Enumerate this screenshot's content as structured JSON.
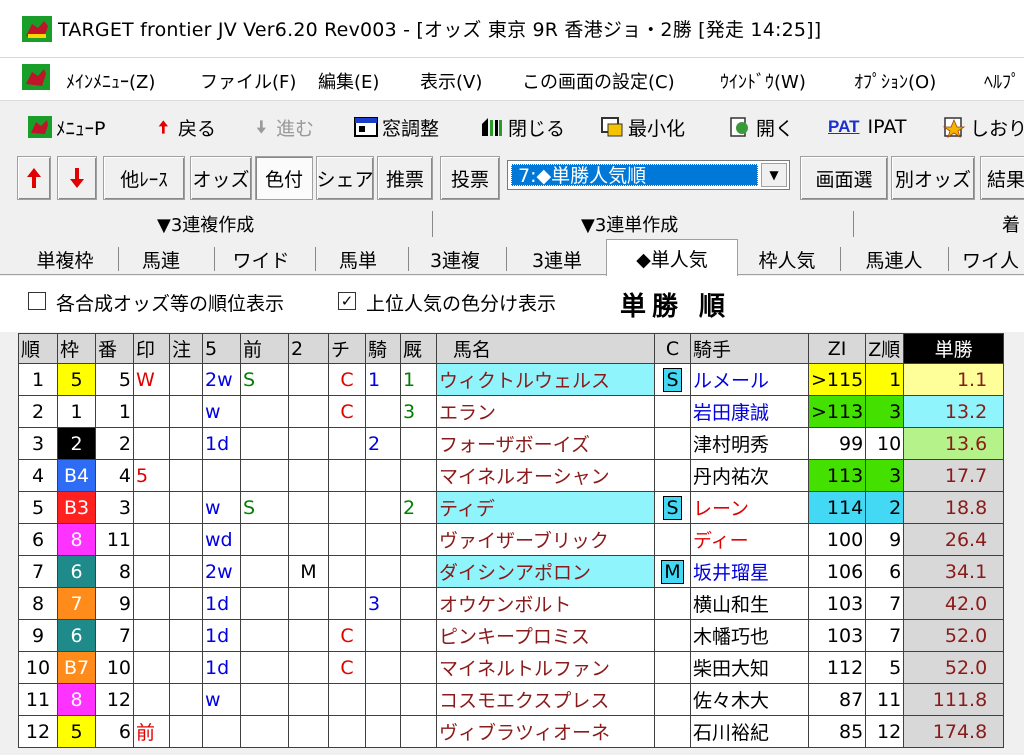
{
  "window": {
    "title": "TARGET frontier JV  Ver6.20  Rev003 - [オッズ 東京 9R 香港ジョ・2勝  [発走 14:25]]"
  },
  "menu": [
    "ﾒｲﾝﾒﾆｭｰ(Z)",
    "ファイル(F)",
    "編集(E)",
    "表示(V)",
    "この画面の設定(C)",
    "ｳｲﾝﾄﾞｳ(W)",
    "ｵﾌﾟｼｮﾝ(O)",
    "ﾍﾙﾌﾟ"
  ],
  "toolbar": {
    "menu_p": "ﾒﾆｭｰP",
    "back": "戻る",
    "forward": "進む",
    "window_adjust": "窓調整",
    "close": "閉じる",
    "minimize": "最小化",
    "open": "開く",
    "pat": "PAT",
    "ipat": "IPAT",
    "bookmark": "しおり"
  },
  "buttons": {
    "other_race": "他ﾚｰｽ",
    "odds": "オッズ",
    "color": "色付",
    "share": "シェア",
    "recommend": "推票",
    "vote": "投票",
    "screen_select": "画面選",
    "other_odds": "別オッズ",
    "result": "結果"
  },
  "combo": {
    "selected": "7:◆単勝人気順"
  },
  "section_headers": [
    "▼3連複作成",
    "▼3連単作成",
    "着"
  ],
  "tabs": [
    "単複枠",
    "馬連",
    "ワイド",
    "馬単",
    "3連複",
    "3連単",
    "◆単人気",
    "枠人気",
    "馬連人",
    "ワイ人"
  ],
  "options": {
    "rank_display": "各合成オッズ等の順位表示",
    "color_popular": "上位人気の色分け表示",
    "title": "単勝 順"
  },
  "colors": {
    "frame1": "#ffffff",
    "frame2": "#000000",
    "frame3": "#ff2020",
    "frame4": "#2f6cf5",
    "frame5": "#ffff00",
    "frame6": "#1f8a8a",
    "frame7": "#ff8c1a",
    "frame8": "#ff33ff"
  },
  "table": {
    "headers": [
      "順",
      "枠",
      "番",
      "印",
      "注",
      "5",
      "前",
      "2",
      "チ",
      "騎",
      "厩",
      "馬名",
      "C",
      "騎手",
      "ZI",
      "Z順",
      "単勝"
    ],
    "rows": [
      {
        "rank": "1",
        "frame": "5",
        "num": "5",
        "mark": "W",
        "note": "",
        "c5": "2w",
        "mae": "S",
        "c2": "",
        "chi": "C",
        "ki": "1",
        "kyu": "1",
        "horse": "ウィクトルウェルス",
        "cflag": "S",
        "jockey": "ルメール",
        "zi": ">115",
        "zrank": "1",
        "odds": "1.1"
      },
      {
        "rank": "2",
        "frame": "1",
        "num": "1",
        "mark": "",
        "note": "",
        "c5": "w",
        "mae": "",
        "c2": "",
        "chi": "C",
        "ki": "",
        "kyu": "3",
        "horse": "エラン",
        "cflag": "",
        "jockey": "岩田康誠",
        "zi": ">113",
        "zrank": "3",
        "odds": "13.2"
      },
      {
        "rank": "3",
        "frame": "2",
        "num": "2",
        "mark": "",
        "note": "",
        "c5": "1d",
        "mae": "",
        "c2": "",
        "chi": "",
        "ki": "2",
        "kyu": "",
        "horse": "フォーザボーイズ",
        "cflag": "",
        "jockey": "津村明秀",
        "zi": "99",
        "zrank": "10",
        "odds": "13.6"
      },
      {
        "rank": "4",
        "frame": "B4",
        "num": "4",
        "mark": "5",
        "note": "",
        "c5": "",
        "mae": "",
        "c2": "",
        "chi": "",
        "ki": "",
        "kyu": "",
        "horse": "マイネルオーシャン",
        "cflag": "",
        "jockey": "丹内祐次",
        "zi": "113",
        "zrank": "3",
        "odds": "17.7"
      },
      {
        "rank": "5",
        "frame": "B3",
        "num": "3",
        "mark": "",
        "note": "",
        "c5": "w",
        "mae": "S",
        "c2": "",
        "chi": "",
        "ki": "",
        "kyu": "2",
        "horse": "ティデ",
        "cflag": "S",
        "jockey": "レーン",
        "zi": "114",
        "zrank": "2",
        "odds": "18.8"
      },
      {
        "rank": "6",
        "frame": "8",
        "num": "11",
        "mark": "",
        "note": "",
        "c5": "wd",
        "mae": "",
        "c2": "",
        "chi": "",
        "ki": "",
        "kyu": "",
        "horse": "ヴァイザーブリック",
        "cflag": "",
        "jockey": "ディー",
        "zi": "100",
        "zrank": "9",
        "odds": "26.4"
      },
      {
        "rank": "7",
        "frame": "6",
        "num": "8",
        "mark": "",
        "note": "",
        "c5": "2w",
        "mae": "",
        "c2": "M",
        "chi": "",
        "ki": "",
        "kyu": "",
        "horse": "ダイシンアポロン",
        "cflag": "M",
        "jockey": "坂井瑠星",
        "zi": "106",
        "zrank": "6",
        "odds": "34.1"
      },
      {
        "rank": "8",
        "frame": "7",
        "num": "9",
        "mark": "",
        "note": "",
        "c5": "1d",
        "mae": "",
        "c2": "",
        "chi": "",
        "ki": "3",
        "kyu": "",
        "horse": "オウケンボルト",
        "cflag": "",
        "jockey": "横山和生",
        "zi": "103",
        "zrank": "7",
        "odds": "42.0"
      },
      {
        "rank": "9",
        "frame": "6",
        "num": "7",
        "mark": "",
        "note": "",
        "c5": "1d",
        "mae": "",
        "c2": "",
        "chi": "C",
        "ki": "",
        "kyu": "",
        "horse": "ピンキープロミス",
        "cflag": "",
        "jockey": "木幡巧也",
        "zi": "103",
        "zrank": "7",
        "odds": "52.0"
      },
      {
        "rank": "10",
        "frame": "B7",
        "num": "10",
        "mark": "",
        "note": "",
        "c5": "1d",
        "mae": "",
        "c2": "",
        "chi": "C",
        "ki": "",
        "kyu": "",
        "horse": "マイネルトルファン",
        "cflag": "",
        "jockey": "柴田大知",
        "zi": "112",
        "zrank": "5",
        "odds": "52.0"
      },
      {
        "rank": "11",
        "frame": "8",
        "num": "12",
        "mark": "",
        "note": "",
        "c5": "w",
        "mae": "",
        "c2": "",
        "chi": "",
        "ki": "",
        "kyu": "",
        "horse": "コスモエクスプレス",
        "cflag": "",
        "jockey": "佐々木大",
        "zi": "87",
        "zrank": "11",
        "odds": "111.8"
      },
      {
        "rank": "12",
        "frame": "5",
        "num": "6",
        "mark": "前",
        "note": "",
        "c5": "",
        "mae": "",
        "c2": "",
        "chi": "",
        "ki": "",
        "kyu": "",
        "horse": "ヴィブラツィオーネ",
        "cflag": "",
        "jockey": "石川裕紀",
        "zi": "85",
        "zrank": "12",
        "odds": "174.8"
      }
    ]
  }
}
